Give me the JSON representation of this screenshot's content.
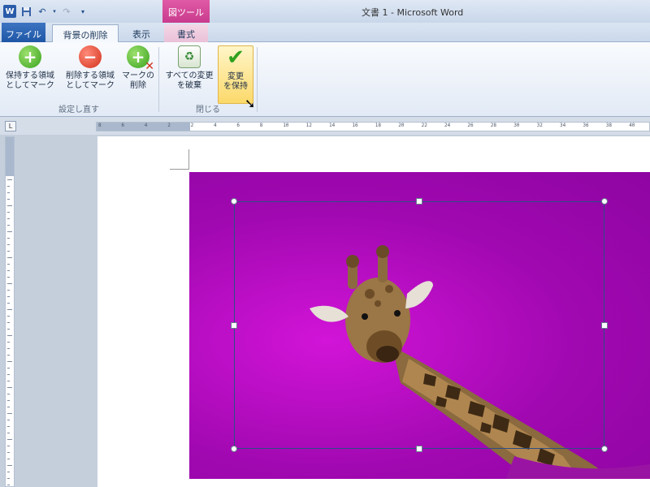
{
  "window": {
    "doc_title": "文書 1 - Microsoft Word",
    "qat_icons": [
      "word-logo",
      "save-icon",
      "undo-icon",
      "redo-icon",
      "customize-icon"
    ],
    "logo_letter": "W"
  },
  "ribbon": {
    "context_group_label": "図ツール",
    "tabs": {
      "file": "ファイル",
      "background_removal": "背景の削除",
      "view": "表示",
      "format": "書式"
    },
    "buttons": {
      "keep": {
        "line1": "保持する領域",
        "line2": "としてマーク"
      },
      "remove": {
        "line1": "削除する領域",
        "line2": "としてマーク"
      },
      "delete_mark": {
        "line1": "マークの",
        "line2": "削除"
      },
      "discard": {
        "line1": "すべての変更",
        "line2": "を破棄"
      },
      "keep_changes": {
        "line1": "変更",
        "line2": "を保持"
      }
    },
    "groups": {
      "refine": "設定し直す",
      "close": "閉じる"
    }
  },
  "ruler": {
    "corner": "L",
    "h_ticks": [
      "8",
      "6",
      "4",
      "2",
      "2",
      "4",
      "6",
      "8",
      "10",
      "12",
      "14",
      "16",
      "18",
      "20",
      "22",
      "24",
      "26",
      "28",
      "30",
      "32",
      "34",
      "36",
      "38",
      "40"
    ]
  },
  "colors": {
    "removed_area": "#b40ac0",
    "context_tab": "#d04a98",
    "file_tab": "#2a62b2",
    "keep_button_highlight": "#fbd96a"
  }
}
